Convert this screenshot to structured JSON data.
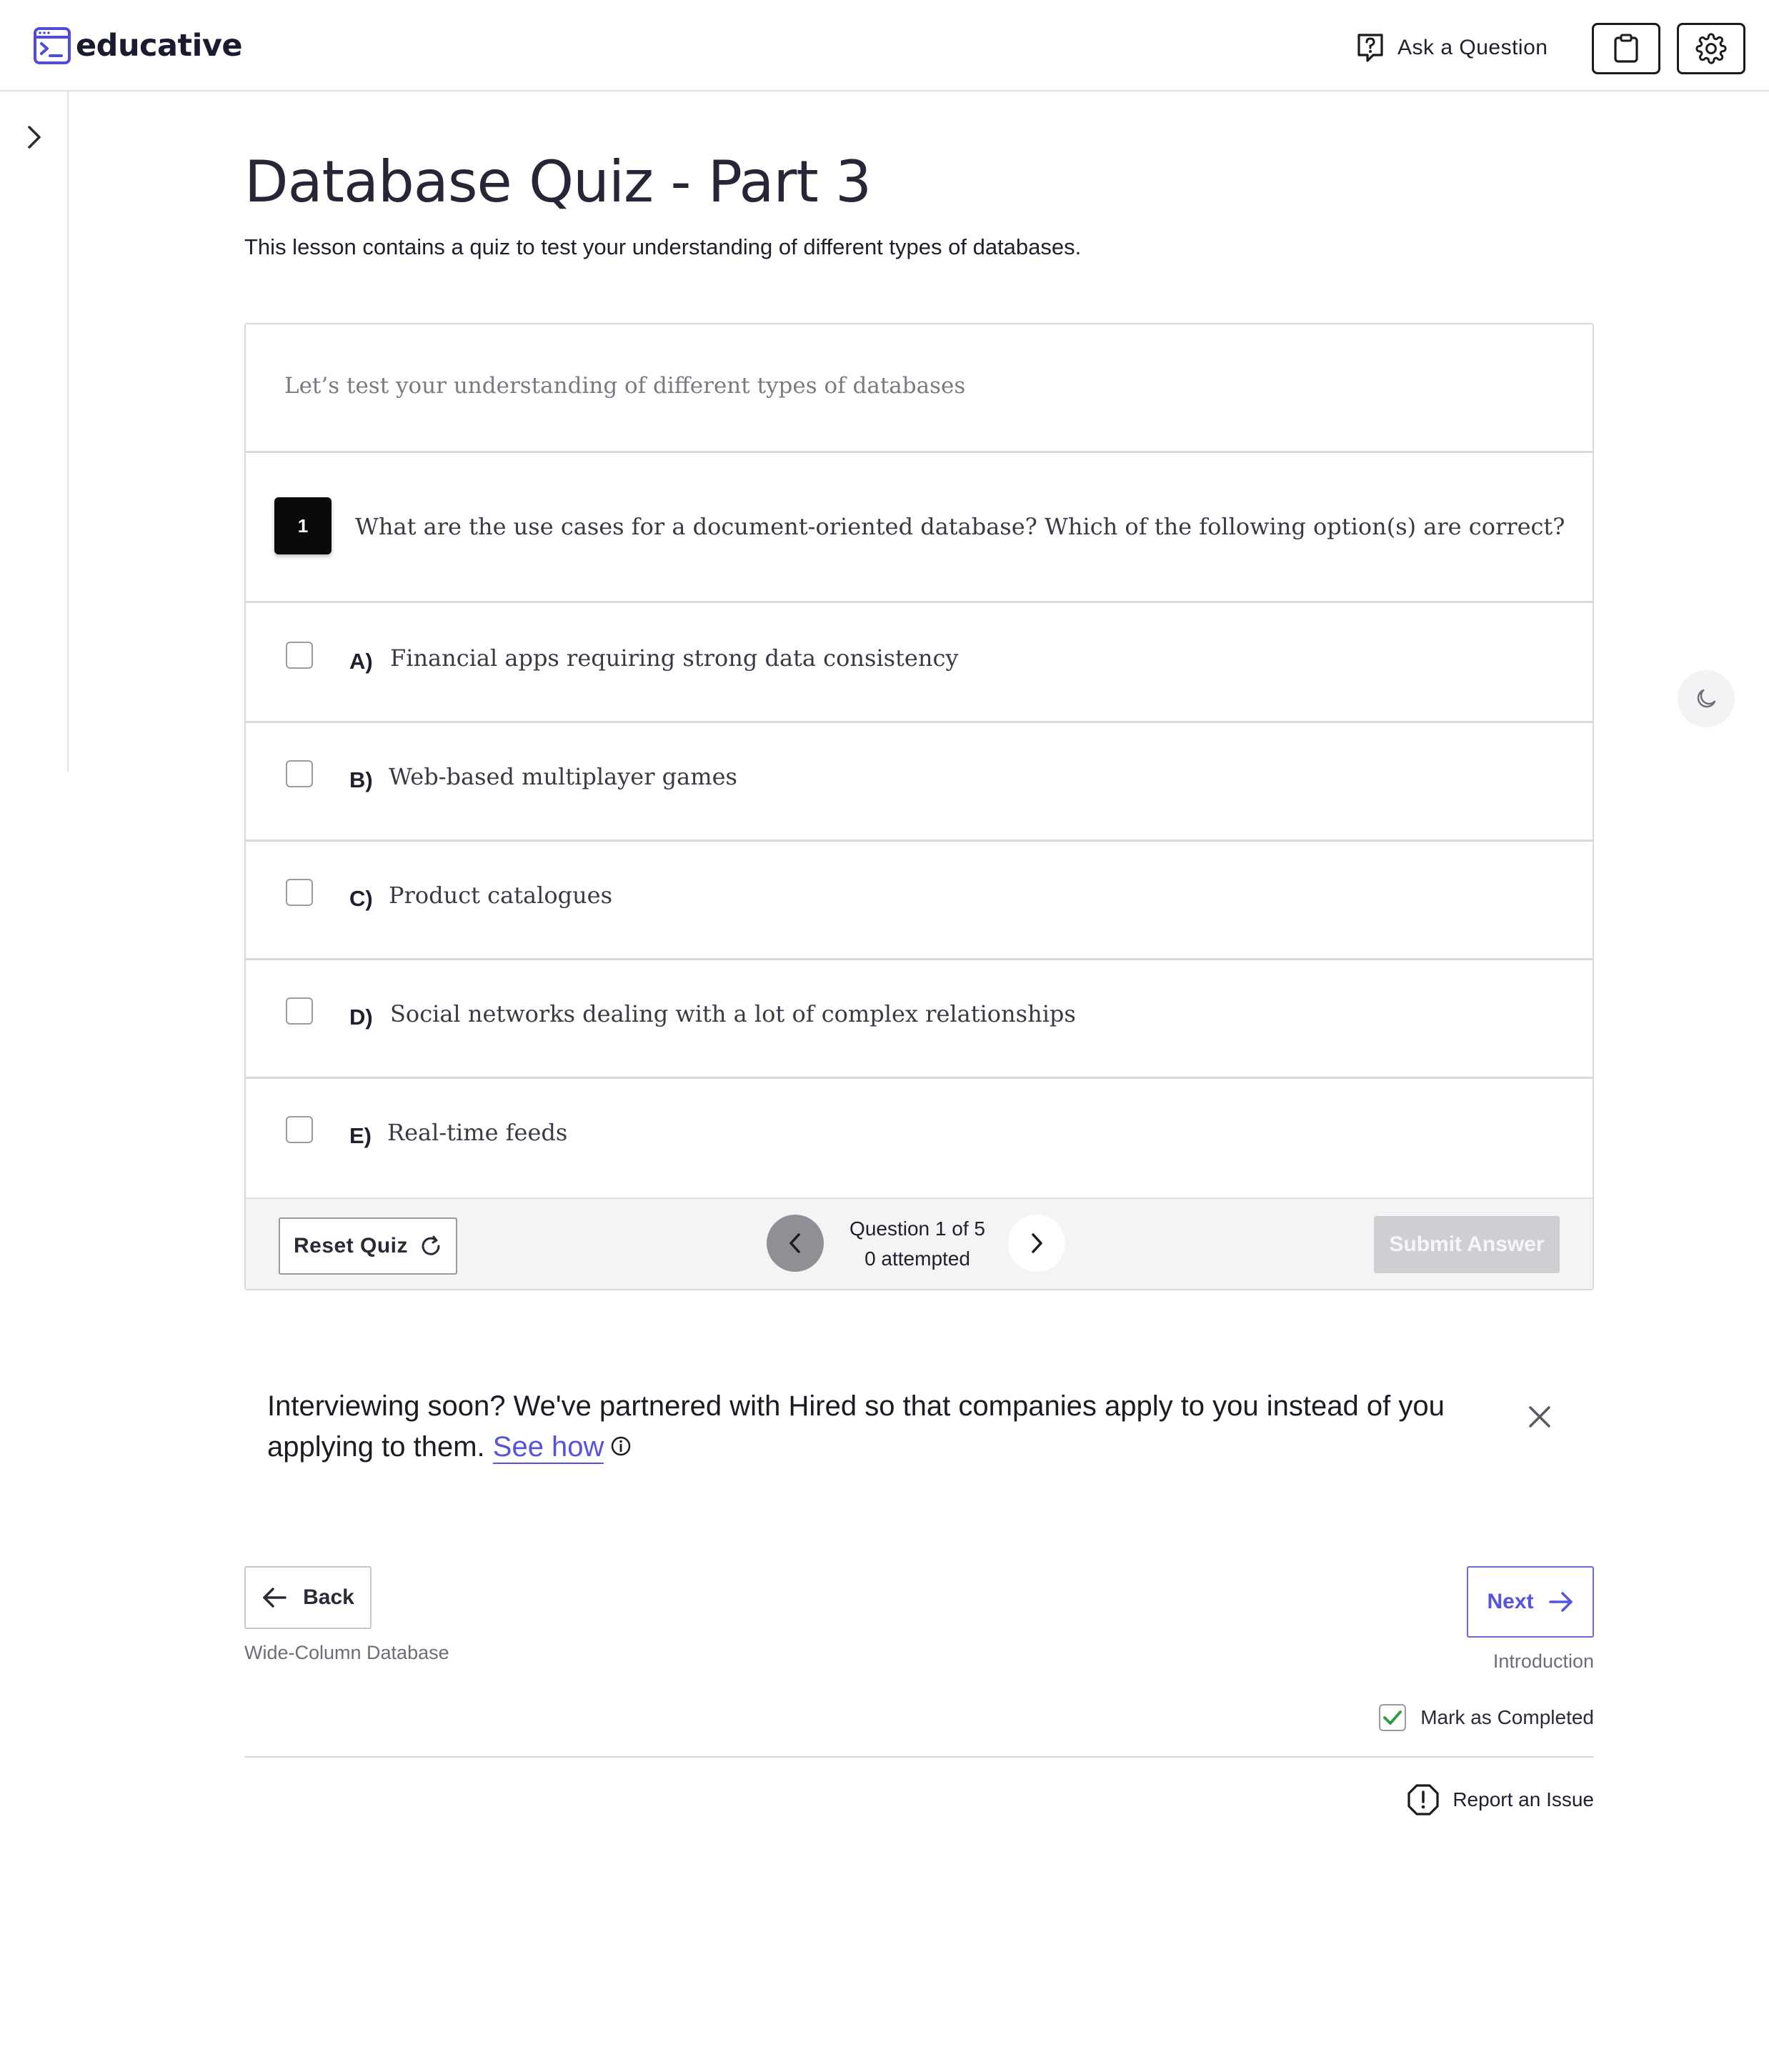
{
  "header": {
    "brand": "educative",
    "ask_label": "Ask a Question",
    "icons": {
      "logo": "terminal-window-icon",
      "ask": "question-bubble-icon",
      "clipboard": "clipboard-icon",
      "settings": "gear-icon"
    }
  },
  "sidebar": {
    "toggle_icon": "chevron-right-icon"
  },
  "lesson": {
    "title": "Database Quiz - Part 3",
    "subtitle": "This lesson contains a quiz to test your understanding of different types of databases."
  },
  "quiz": {
    "intro": "Let’s test your understanding of different types of databases",
    "question_number": "1",
    "question": "What are the use cases for a document-oriented database? Which of the following option(s) are correct?",
    "options": [
      {
        "letter": "A)",
        "text": "Financial apps requiring strong data consistency",
        "checked": false
      },
      {
        "letter": "B)",
        "text": "Web-based multiplayer games",
        "checked": false
      },
      {
        "letter": "C)",
        "text": "Product catalogues",
        "checked": false
      },
      {
        "letter": "D)",
        "text": "Social networks dealing with a lot of complex relationships",
        "checked": false
      },
      {
        "letter": "E)",
        "text": "Real-time feeds",
        "checked": false
      }
    ],
    "footer": {
      "reset_label": "Reset Quiz",
      "progress_line1": "Question 1 of 5",
      "progress_line2": "0 attempted",
      "submit_label": "Submit Answer"
    }
  },
  "promo": {
    "text": "Interviewing soon? We've partnered with Hired so that companies apply to you instead of you applying to them.",
    "link_label": "See how"
  },
  "navigation": {
    "back_label": "Back",
    "back_lesson": "Wide-Column Database",
    "next_label": "Next",
    "next_lesson": "Introduction",
    "mark_completed_label": "Mark as Completed",
    "mark_completed_checked": true,
    "report_label": "Report an Issue"
  },
  "colors": {
    "accent": "#5553e0",
    "check_green": "#2e9c3a",
    "submit_disabled": "#cfcfd3"
  }
}
